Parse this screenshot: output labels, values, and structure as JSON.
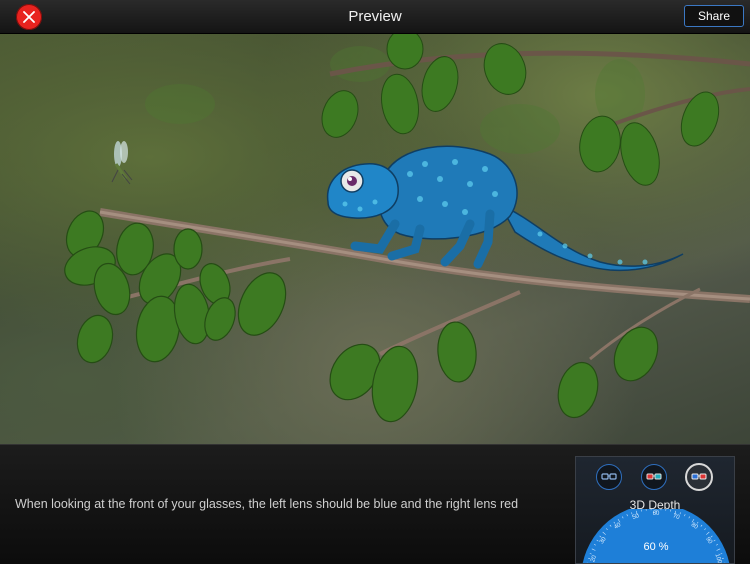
{
  "header": {
    "title": "Preview",
    "share_label": "Share"
  },
  "instruction_text": "When looking at the front of your glasses, the left lens should be blue and the right lens red",
  "depth_control": {
    "label": "3D Depth",
    "value_percent": 60,
    "value_text": "60 %",
    "dial_ticks": [
      "20",
      "30",
      "40",
      "50",
      "60",
      "70",
      "80",
      "90",
      "100"
    ],
    "glasses_modes": [
      "red-blue-glasses-icon",
      "red-cyan-glasses-icon",
      "blue-red-glasses-icon"
    ],
    "selected_mode_index": 2
  },
  "colors": {
    "accent_blue": "#1e88e5",
    "close_red": "#e8231f",
    "share_border": "#3b78c4"
  }
}
